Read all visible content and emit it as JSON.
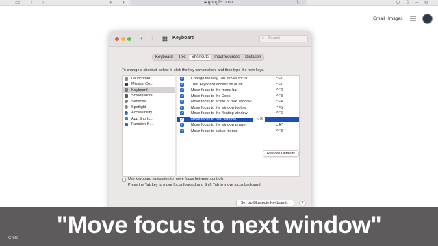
{
  "browser": {
    "url": "google.com",
    "icons": [
      "sidebar-icon",
      "chevron-left-icon",
      "chevron-right-icon",
      "shield-icon",
      "lock-icon",
      "reload-icon",
      "download-icon",
      "share-icon",
      "plus-icon",
      "tabs-icon"
    ]
  },
  "google": {
    "gmail_label": "Gmail",
    "images_label": "Images"
  },
  "window": {
    "title": "Keyboard",
    "search_placeholder": "Search",
    "tabs": [
      {
        "label": "Keyboard",
        "active": false
      },
      {
        "label": "Text",
        "active": false
      },
      {
        "label": "Shortcuts",
        "active": true
      },
      {
        "label": "Input Sources",
        "active": false
      },
      {
        "label": "Dictation",
        "active": false
      }
    ],
    "instructions": "To change a shortcut, select it, click the key combination, and then type the new keys.",
    "categories": [
      {
        "label": "Launchpad...",
        "icon": "launchpad-icon",
        "color": "#8a8a9a",
        "selected": false
      },
      {
        "label": "Mission Co...",
        "icon": "mission-control-icon",
        "color": "#3a3a3a",
        "selected": false
      },
      {
        "label": "Keyboard",
        "icon": "keyboard-icon",
        "color": "#7b7b7b",
        "selected": true
      },
      {
        "label": "Screenshots",
        "icon": "screenshot-icon",
        "color": "#5a5a5a",
        "selected": false
      },
      {
        "label": "Services",
        "icon": "gear-icon",
        "color": "#7b7b7b",
        "selected": false
      },
      {
        "label": "Spotlight",
        "icon": "spotlight-icon",
        "color": "#888888",
        "selected": false
      },
      {
        "label": "Accessibility",
        "icon": "accessibility-icon",
        "color": "#2b68c8",
        "selected": false
      },
      {
        "label": "App Shortc...",
        "icon": "app-shortcuts-icon",
        "color": "#4a7bd0",
        "selected": false
      },
      {
        "label": "Function K...",
        "icon": "function-keys-icon",
        "color": "#2b68c8",
        "selected": false
      }
    ],
    "shortcuts": [
      {
        "label": "Change the way Tab moves focus",
        "key": "^F7",
        "checked": true,
        "selected": false
      },
      {
        "label": "Turn keyboard access on or off",
        "key": "^F1",
        "checked": true,
        "selected": false
      },
      {
        "label": "Move focus to the menu bar",
        "key": "^F2",
        "checked": true,
        "selected": false
      },
      {
        "label": "Move focus to the Dock",
        "key": "^F3",
        "checked": true,
        "selected": false
      },
      {
        "label": "Move focus to active or next window",
        "key": "^F4",
        "checked": true,
        "selected": false
      },
      {
        "label": "Move focus to the window toolbar",
        "key": "^F5",
        "checked": true,
        "selected": false
      },
      {
        "label": "Move focus to the floating window",
        "key": "^F6",
        "checked": true,
        "selected": false
      },
      {
        "label": "Move focus to next window",
        "key": "⌥⌘",
        "checked": true,
        "selected": true
      },
      {
        "label": "Move focus to the window drawer",
        "key": "⌥⌘'",
        "checked": true,
        "selected": false
      },
      {
        "label": "Move focus to status menus",
        "key": "^F8",
        "checked": true,
        "selected": false
      }
    ],
    "restore_defaults": "Restore Defaults",
    "keyboard_nav_label": "Use keyboard navigation to move focus between controls",
    "keyboard_nav_hint": "Press the Tab key to move focus forward and Shift Tab to move focus backward.",
    "bluetooth_button": "Set Up Bluetooth Keyboard...",
    "help_button": "?"
  },
  "caption": "\"Move focus to next window\"",
  "footer_country": "Chile",
  "colors": {
    "selection_blue": "#1a4fb8",
    "checkbox_blue": "#2b68c8",
    "caption_bg": "#5d5b5b"
  }
}
